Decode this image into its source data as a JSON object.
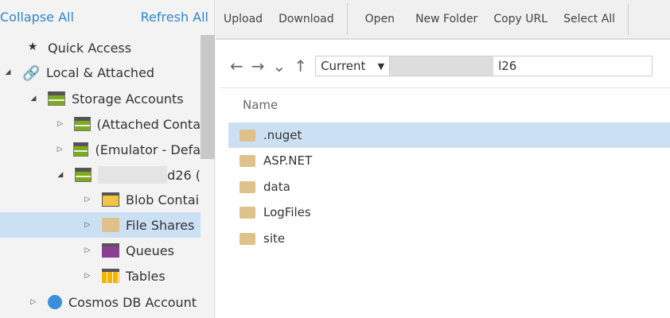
{
  "sidebar": {
    "collapse_all": "Collapse All",
    "refresh_all": "Refresh All",
    "tree": [
      {
        "label": "Quick Access",
        "icon": "quick-access-icon"
      },
      {
        "label": "Local & Attached",
        "icon": "link-icon"
      },
      {
        "label": "Storage Accounts",
        "icon": "storage-account-icon"
      },
      {
        "label": "(Attached Conta",
        "icon": "storage-account-icon"
      },
      {
        "label": "(Emulator - Defa",
        "icon": "storage-account-icon"
      },
      {
        "label": "d26 (",
        "icon": "storage-account-icon"
      },
      {
        "label": "Blob Contai",
        "icon": "blob-container-icon"
      },
      {
        "label": "File Shares",
        "icon": "file-share-icon"
      },
      {
        "label": "Queues",
        "icon": "queue-icon"
      },
      {
        "label": "Tables",
        "icon": "table-icon"
      },
      {
        "label": "Cosmos DB Account",
        "icon": "cosmos-db-icon"
      }
    ]
  },
  "toolbar": {
    "upload": "Upload",
    "download": "Download",
    "open": "Open",
    "new_folder": "New Folder",
    "copy_url": "Copy URL",
    "select_all": "Select All"
  },
  "nav": {
    "scope": "Current",
    "path": "l26"
  },
  "list": {
    "header": "Name",
    "items": [
      ".nuget",
      "ASP.NET",
      "data",
      "LogFiles",
      "site"
    ]
  },
  "colors": {
    "accent": "#2f86d0",
    "selection": "#cce0f4"
  }
}
